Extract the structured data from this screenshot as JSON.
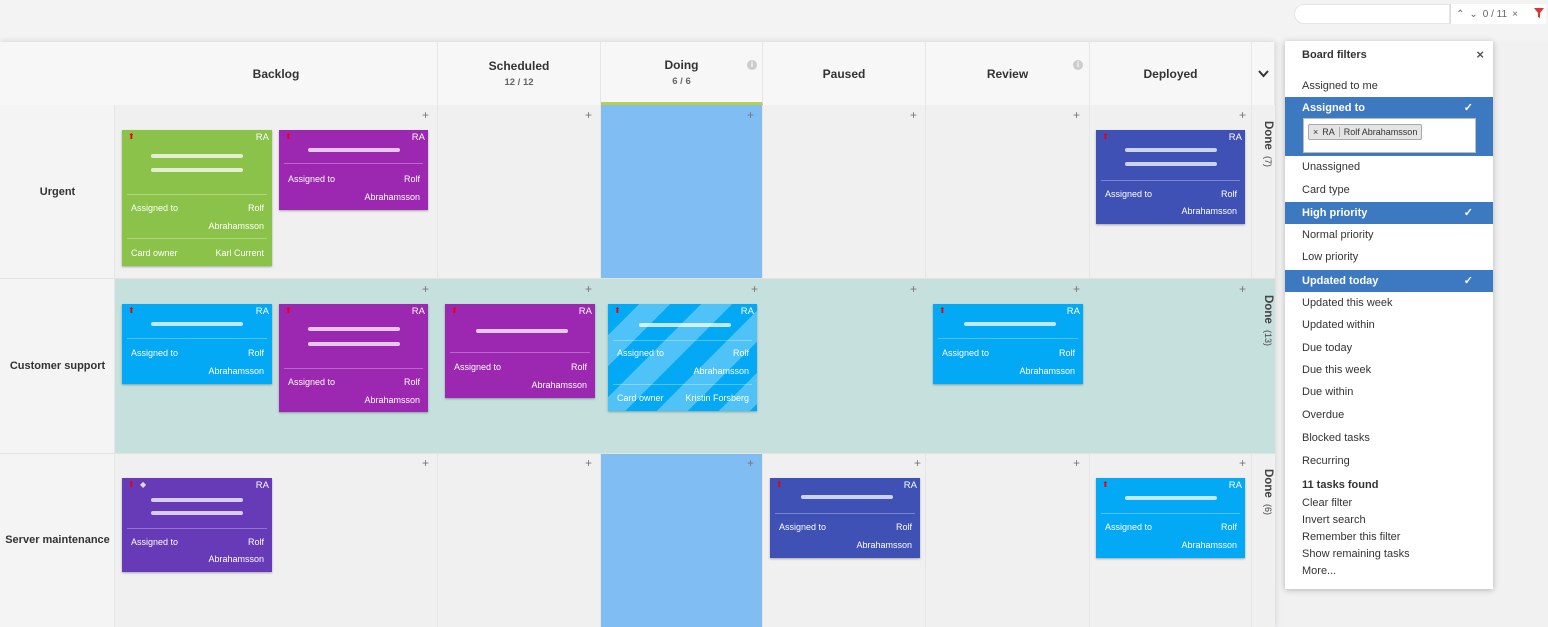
{
  "search": {
    "counter": "0 / 11",
    "up_icon": "⌃",
    "down_icon": "⌄",
    "clear_icon": "×"
  },
  "columns": [
    {
      "title": "Backlog"
    },
    {
      "title": "Scheduled",
      "count": "12 / 12"
    },
    {
      "title": "Doing",
      "count": "6 / 6"
    },
    {
      "title": "Paused"
    },
    {
      "title": "Review"
    },
    {
      "title": "Deployed"
    }
  ],
  "lanes": [
    {
      "title": "Urgent",
      "done_label": "Done",
      "done_count": "(7)"
    },
    {
      "title": "Customer support",
      "done_label": "Done",
      "done_count": "(13)"
    },
    {
      "title": "Server maintenance",
      "done_label": "Done",
      "done_count": "(6)"
    }
  ],
  "card": {
    "initials": "RA",
    "assigned_label": "Assigned to",
    "assigned_first": "Rolf",
    "assigned_last": "Abrahamsson",
    "owner_label": "Card owner",
    "owner_karl": "Karl Current",
    "owner_kristin": "Kristin Forsberg"
  },
  "colors": {
    "green": "#8bc34a",
    "purple": "#9c27b0",
    "blue": "#03a9f4",
    "indigo": "#3f51b5",
    "violet": "#673ab7",
    "doing": "#7fbdf3",
    "lane_hl": "#c5e0dd",
    "filter_sel": "#3d79c1"
  },
  "filters": {
    "title": "Board filters",
    "close": "×",
    "assigned_to_me": "Assigned to me",
    "assigned_to": "Assigned to",
    "chip_initials": "RA",
    "chip_name": "Rolf Abrahamsson",
    "chip_remove": "×",
    "unassigned": "Unassigned",
    "card_type": "Card type",
    "high_priority": "High priority",
    "normal_priority": "Normal priority",
    "low_priority": "Low priority",
    "updated_today": "Updated today",
    "updated_this_week": "Updated this week",
    "updated_within": "Updated within",
    "due_today": "Due today",
    "due_this_week": "Due this week",
    "due_within": "Due within",
    "overdue": "Overdue",
    "blocked_tasks": "Blocked tasks",
    "recurring": "Recurring",
    "tasks_found": "11 tasks found",
    "clear_filter": "Clear filter",
    "invert_search": "Invert search",
    "remember_filter": "Remember this filter",
    "show_remaining": "Show remaining tasks",
    "more": "More...",
    "check": "✓"
  }
}
